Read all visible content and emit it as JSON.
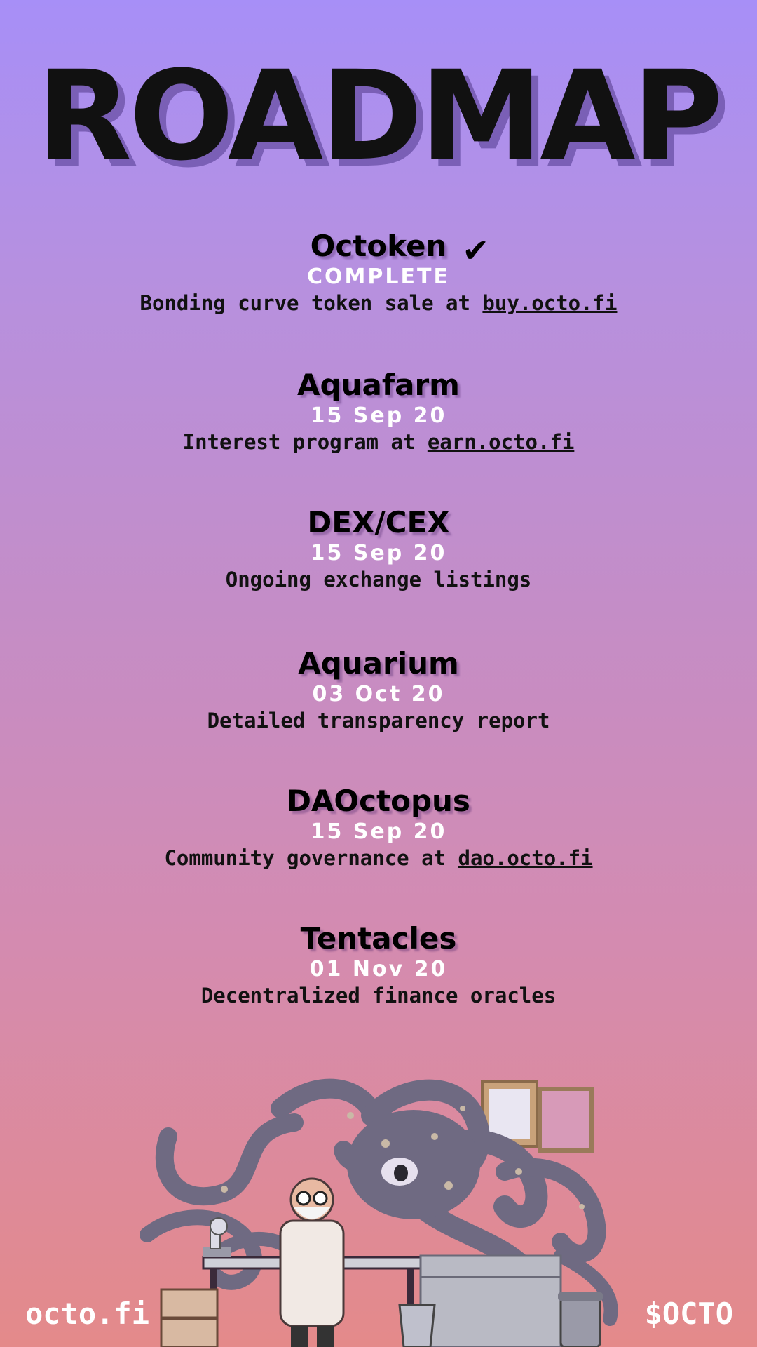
{
  "title": "ROADMAP",
  "milestones": [
    {
      "name": "Octoken",
      "status": "COMPLETE",
      "desc_prefix": "Bonding curve token sale at ",
      "link": "buy.octo.fi"
    },
    {
      "name": "Aquafarm",
      "status": "15 Sep 20",
      "desc_prefix": "Interest program at ",
      "link": "earn.octo.fi"
    },
    {
      "name": "DEX/CEX",
      "status": "15 Sep 20",
      "desc_prefix": "Ongoing exchange listings",
      "link": ""
    },
    {
      "name": "Aquarium",
      "status": "03 Oct 20",
      "desc_prefix": "Detailed transparency report",
      "link": ""
    },
    {
      "name": "DAOctopus",
      "status": "15 Sep 20",
      "desc_prefix": "Community governance at ",
      "link": "dao.octo.fi"
    },
    {
      "name": "Tentacles",
      "status": "01 Nov 20",
      "desc_prefix": "Decentralized finance oracles",
      "link": ""
    }
  ],
  "checkmark": "✔",
  "footer": {
    "left": "octo.fi",
    "right": "$OCTO"
  },
  "colors": {
    "text": "#111111",
    "date": "#ffffff",
    "bg_top": "#a78ff7",
    "bg_bottom": "#e48a8a"
  }
}
